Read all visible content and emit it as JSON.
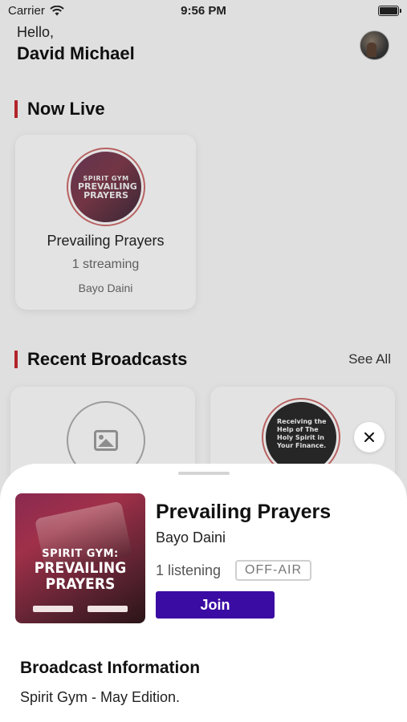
{
  "status_bar": {
    "carrier": "Carrier",
    "time": "9:56 PM"
  },
  "header": {
    "greeting": "Hello,",
    "username": "David Michael"
  },
  "now_live": {
    "section_title": "Now Live",
    "card": {
      "cover_line1": "SPIRIT GYM",
      "cover_line2": "PREVAILING PRAYERS",
      "title": "Prevailing Prayers",
      "streaming": "1 streaming",
      "host": "Bayo Daini"
    }
  },
  "recent": {
    "section_title": "Recent Broadcasts",
    "see_all": "See All",
    "card2_text": "Receiving the Help of The Holy Spirit in Your Finance."
  },
  "sheet": {
    "cover_line1": "SPIRIT GYM:",
    "cover_line2": "PREVAILING PRAYERS",
    "title": "Prevailing Prayers",
    "host": "Bayo Daini",
    "listening": "1 listening",
    "status_badge": "OFF-AIR",
    "join_label": "Join",
    "info_heading": "Broadcast Information",
    "info_text": "Spirit Gym - May Edition."
  },
  "colors": {
    "accent_bar": "#c0282d",
    "join_button": "#3a0ca3"
  }
}
